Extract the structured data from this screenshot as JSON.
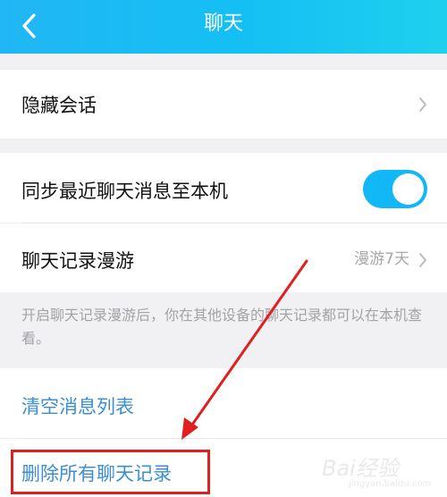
{
  "header": {
    "title": "聊天"
  },
  "rows": {
    "hide_conversation": "隐藏会话",
    "sync_messages": "同步最近聊天消息至本机",
    "chat_roaming": "聊天记录漫游",
    "chat_roaming_value": "漫游7天",
    "clear_message_list": "清空消息列表",
    "delete_all_records": "删除所有聊天记录"
  },
  "hint": "开启聊天记录漫游后，你在其他设备的聊天记录都可以在本机查看。",
  "toggle": {
    "sync_enabled": true
  },
  "colors": {
    "header_start": "#21b6f5",
    "header_end": "#1fd0ee",
    "toggle_on": "#12b7f5",
    "action_blue": "#3b8ed3",
    "annotation_red": "#e02020"
  },
  "watermark": {
    "text": "Bai经验",
    "sub": "jingyan.baidu.com"
  }
}
